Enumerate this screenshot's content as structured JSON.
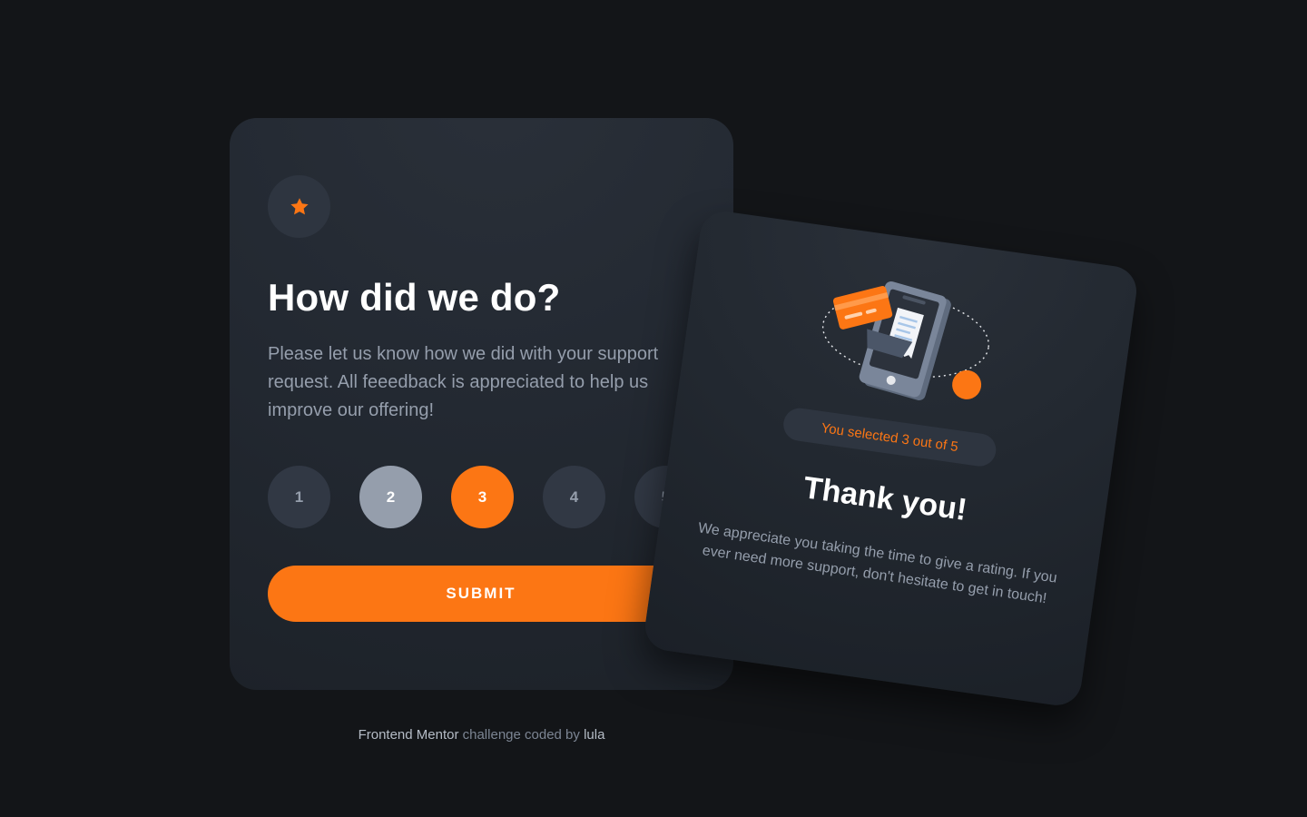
{
  "rating_card": {
    "star_icon": "star-icon",
    "title": "How did we do?",
    "description": "Please let us know how we did with your support request. All feeedback is appreciated to help us improve our offering!",
    "options": [
      "1",
      "2",
      "3",
      "4",
      "5"
    ],
    "hovered": "2",
    "selected": "3",
    "submit_label": "SUBMIT"
  },
  "thankyou_card": {
    "illustration_icon": "payment-phone-illustration",
    "selection_text": "You selected 3 out of 5",
    "title": "Thank you!",
    "message": "We appreciate you taking the time to give a rating. If you ever need more support, don't hesitate to get in touch!"
  },
  "attribution": {
    "site": "Frontend Mentor",
    "middle": "challenge coded by",
    "author": "lula"
  },
  "colors": {
    "background": "#131518",
    "card": "#242a33",
    "accent": "#fc7614",
    "muted_text": "#959eac",
    "circle": "#313844"
  }
}
